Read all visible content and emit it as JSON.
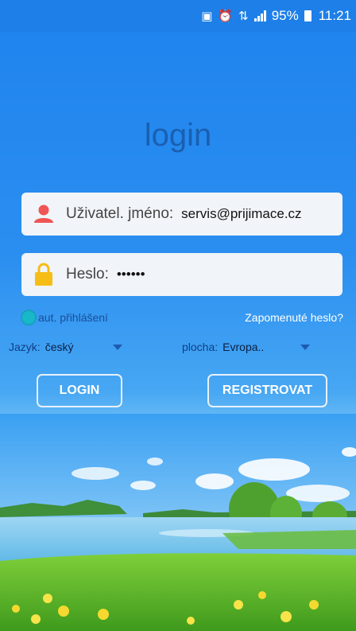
{
  "status_bar": {
    "battery": "95%",
    "time": "11:21",
    "icons": [
      "cast-icon",
      "alarm-icon",
      "data-icon",
      "signal-icon",
      "battery-icon"
    ]
  },
  "title": "login",
  "username": {
    "label": "Uživatel. jméno:",
    "value": "servis@prijimace.cz",
    "icon": "user-icon"
  },
  "password": {
    "label": "Heslo:",
    "value": "••••••",
    "icon": "lock-icon"
  },
  "auto_login": {
    "label": "aut. přihlášení",
    "checked": false
  },
  "forgot_password": "Zapomenuté heslo?",
  "language": {
    "label": "Jazyk:",
    "value": "český"
  },
  "area": {
    "label": "plocha:",
    "value": "Evropa.."
  },
  "buttons": {
    "login": "LOGIN",
    "register": "REGISTROVAT"
  },
  "colors": {
    "background": "#2a8cef",
    "title": "#1a5fb0",
    "user_icon": "#f05454",
    "lock_icon": "#f6bd16"
  }
}
